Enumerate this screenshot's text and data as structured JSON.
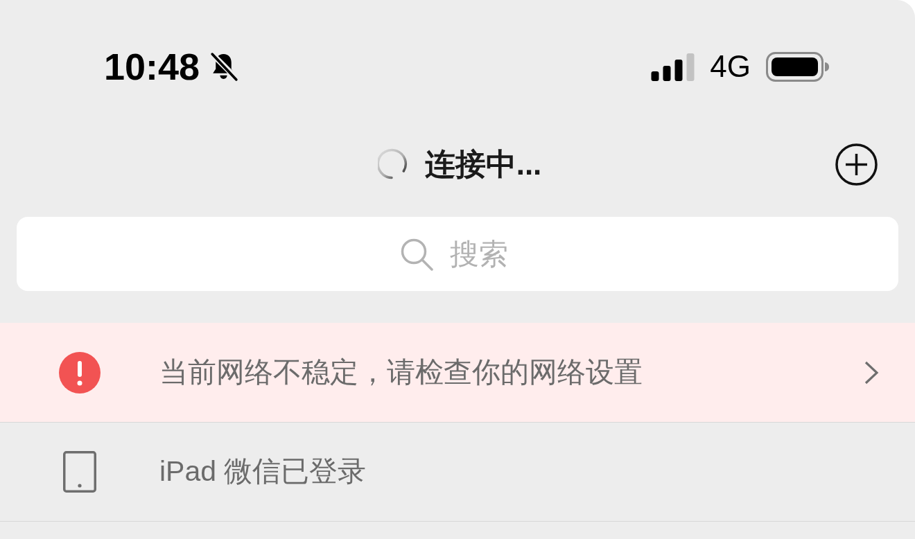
{
  "status_bar": {
    "time": "10:48",
    "silent": true,
    "network": "4G"
  },
  "nav": {
    "title": "连接中...",
    "loading": true
  },
  "search": {
    "placeholder": "搜索"
  },
  "notices": [
    {
      "kind": "warning",
      "text": "当前网络不稳定，请检查你的网络设置"
    },
    {
      "kind": "device",
      "text": "iPad 微信已登录"
    }
  ]
}
